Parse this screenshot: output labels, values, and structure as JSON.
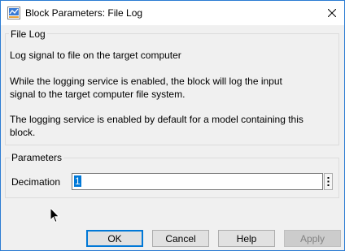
{
  "window": {
    "title": "Block Parameters: File Log",
    "icons": {
      "app": "simulink-block-icon",
      "close": "close-icon"
    },
    "accent_color": "#2b7cd3"
  },
  "description_group": {
    "label": "File Log",
    "lines": [
      "Log signal to file on the target computer",
      "While the logging service is enabled, the block will log the input",
      "signal to the target computer file system.",
      "The logging service is enabled by default for a model containing this",
      "block."
    ]
  },
  "parameters_group": {
    "label": "Parameters",
    "decimation": {
      "label": "Decimation",
      "value": "1"
    }
  },
  "buttons": {
    "ok": "OK",
    "cancel": "Cancel",
    "help": "Help",
    "apply": "Apply"
  }
}
